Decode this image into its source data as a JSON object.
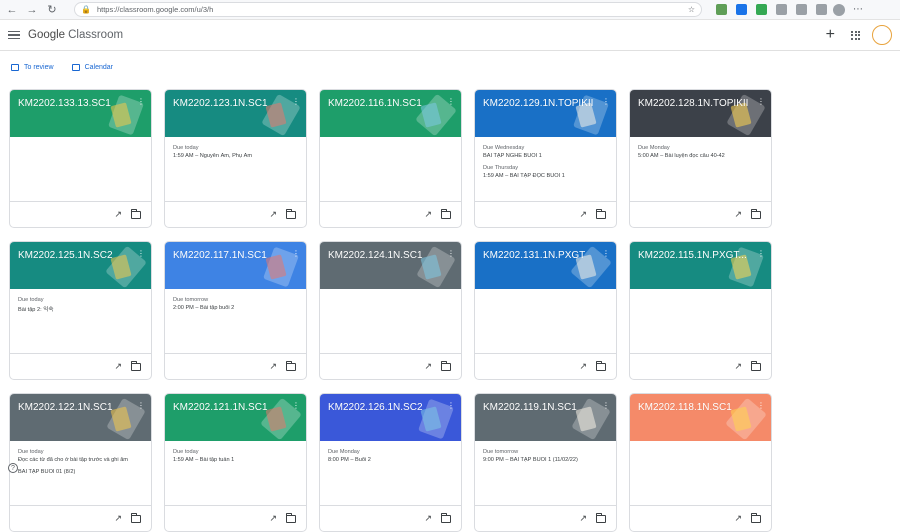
{
  "browser": {
    "url": "https://classroom.google.com/u/3/h"
  },
  "app": {
    "logo_google": "Google",
    "logo_classroom": "Classroom",
    "plus_label": "+"
  },
  "links": [
    {
      "label": "To review",
      "icon": "to-review-icon"
    },
    {
      "label": "Calendar",
      "icon": "calendar-icon"
    }
  ],
  "colors": {
    "green": "#1e9e6a",
    "teal": "#168b81",
    "blue": "#1970c6",
    "lightblue": "#3e83e4",
    "slate": "#5f6b72",
    "dark": "#3c4149",
    "royal": "#3a58d9",
    "orange": "#f58a69"
  },
  "cards": [
    {
      "title": "KM2202.133.13.SC1",
      "color": "green",
      "items": []
    },
    {
      "title": "KM2202.123.1N.SC1",
      "color": "teal",
      "items": [
        {
          "due": "Due today",
          "task": "1:59 AM – Nguyên Âm, Phụ Âm"
        }
      ]
    },
    {
      "title": "KM2202.116.1N.SC1",
      "color": "green",
      "items": []
    },
    {
      "title": "KM2202.129.1N.TOPIKII",
      "color": "blue",
      "items": [
        {
          "due": "Due Wednesday",
          "task": "BÀI TẬP NGHE BUỔI 1"
        },
        {
          "due": "Due Thursday",
          "task": "1:59 AM – BÀI TẬP ĐỌC BUỔI 1"
        }
      ]
    },
    {
      "title": "KM2202.128.1N.TOPIKII",
      "color": "dark",
      "items": [
        {
          "due": "Due Monday",
          "task": "5:00 AM – Bài luyện đọc câu 40-42"
        }
      ]
    },
    {
      "title": "KM2202.125.1N.SC2",
      "color": "teal",
      "items": [
        {
          "due": "Due today",
          "task": "Bài tập 2: 익숙"
        }
      ]
    },
    {
      "title": "KM2202.117.1N.SC1",
      "color": "lightblue",
      "items": [
        {
          "due": "Due tomorrow",
          "task": "2:00 PM – Bài tập buổi 2"
        }
      ]
    },
    {
      "title": "KM2202.124.1N.SC1",
      "color": "slate",
      "items": []
    },
    {
      "title": "KM2202.131.1N.PXGT",
      "color": "blue",
      "items": []
    },
    {
      "title": "KM2202.115.1N.PXGT...",
      "color": "teal",
      "items": []
    },
    {
      "title": "KM2202.122.1N.SC1",
      "color": "slate",
      "items": [
        {
          "due": "Due today",
          "task": "Đọc các từ đã cho ở bài tập trước và ghi âm"
        },
        {
          "due": "",
          "task": "BÀI TẬP BUỔI 01 (8/2)"
        }
      ]
    },
    {
      "title": "KM2202.121.1N.SC1",
      "color": "green",
      "items": [
        {
          "due": "Due today",
          "task": "1:59 AM – Bài tập tuần 1"
        }
      ]
    },
    {
      "title": "KM2202.126.1N.SC2",
      "color": "royal",
      "items": [
        {
          "due": "Due Monday",
          "task": "8:00 PM – Buổi 2"
        }
      ]
    },
    {
      "title": "KM2202.119.1N.SC1",
      "color": "slate",
      "items": [
        {
          "due": "Due tomorrow",
          "task": "9:00 PM – BÀI TẬP BUỔI 1 (11/02/22)"
        }
      ]
    },
    {
      "title": "KM2202.118.1N.SC1",
      "color": "orange",
      "items": []
    }
  ]
}
